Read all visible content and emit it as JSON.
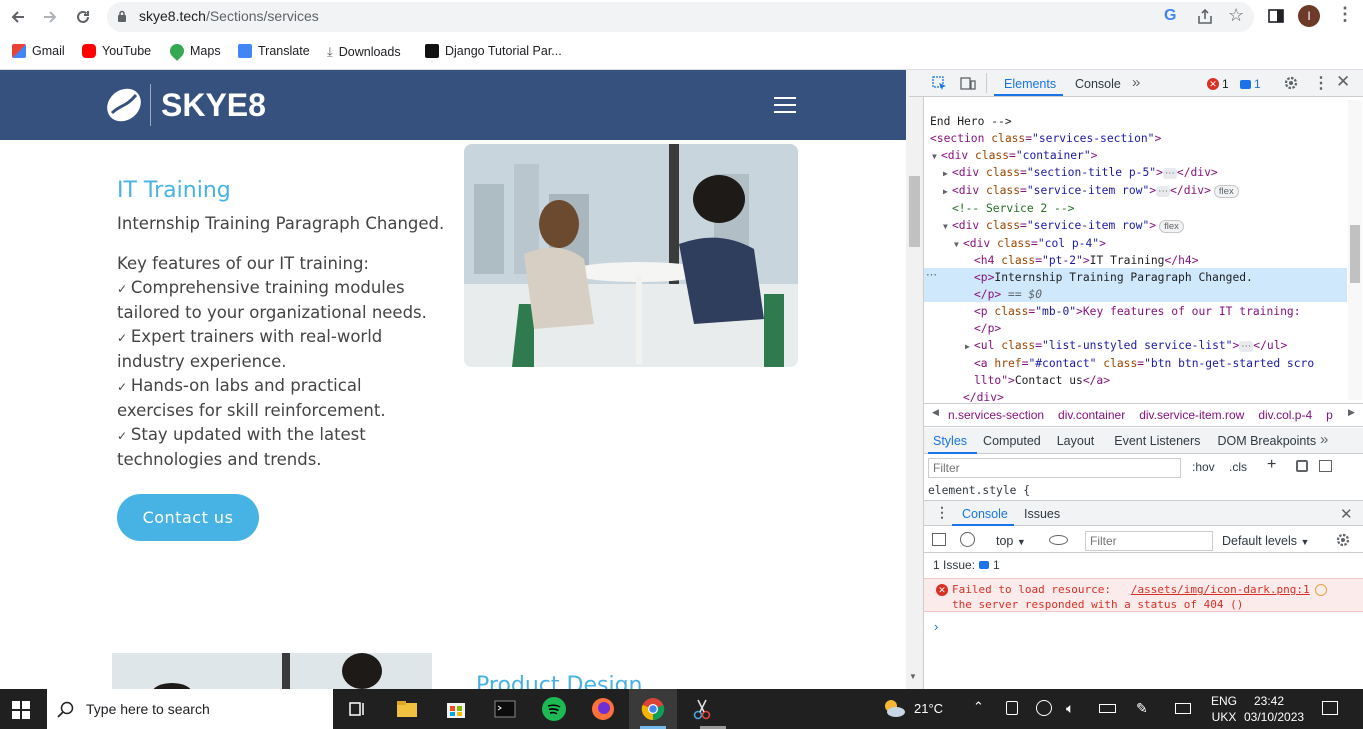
{
  "browser": {
    "url_host": "skye8.tech",
    "url_path": "/Sections/services",
    "profile_initial": "I"
  },
  "bookmarks": [
    {
      "label": "Gmail",
      "icon": "gmail-icon"
    },
    {
      "label": "YouTube",
      "icon": "youtube-icon"
    },
    {
      "label": "Maps",
      "icon": "maps-icon"
    },
    {
      "label": "Translate",
      "icon": "translate-icon"
    },
    {
      "label": "Downloads",
      "icon": "download-icon"
    },
    {
      "label": "Django Tutorial Par...",
      "icon": "django-icon"
    }
  ],
  "site": {
    "logo_text": "SKYE8",
    "service_title": "IT Training",
    "paragraph": "Internship Training Paragraph Changed.",
    "key_features_heading": "Key features of our IT training:",
    "features": [
      "Comprehensive training modules tailored to your organizational needs.",
      "Expert trainers with real-world industry experience.",
      "Hands-on labs and practical exercises for skill reinforcement.",
      "Stay updated with the latest technologies and trends."
    ],
    "contact_button": "Contact us",
    "next_title": "Product Design"
  },
  "devtools": {
    "tabs": [
      "Elements",
      "Console"
    ],
    "active_tab": "Elements",
    "error_count": "1",
    "message_count": "1",
    "dom_lines": [
      {
        "indent": 2,
        "html": "</section><span class='txt'>End Hero --></span>"
      },
      {
        "indent": 2,
        "arrow": "▼",
        "html": "<section class=\"services-section\">"
      },
      {
        "indent": 3,
        "arrow": "▼",
        "html": "<div class=\"container\">"
      },
      {
        "indent": 4,
        "arrow": "▶",
        "html": "<div class=\"section-title p-5\">",
        "ellipsis": true,
        "close": "</div>"
      },
      {
        "indent": 4,
        "arrow": "▶",
        "html": "<div class=\"service-item row\">",
        "ellipsis": true,
        "close": "</div>",
        "badge": "flex"
      },
      {
        "indent": 4,
        "comment": "<!-- Service 2 -->"
      },
      {
        "indent": 4,
        "arrow": "▼",
        "html": "<div class=\"service-item row\">",
        "badge": "flex"
      },
      {
        "indent": 5,
        "arrow": "▼",
        "html": "<div class=\"col p-4\">"
      },
      {
        "indent": 6,
        "html": "<h4 class=\"pt-2\">IT Training</h4>"
      },
      {
        "indent": 6,
        "html": "<p>Internship Training Paragraph Changed.",
        "selected": true
      },
      {
        "indent": 6,
        "html": "</p> == $0",
        "selected": true
      },
      {
        "indent": 6,
        "html": "<p class=\"mb-0\">Key features of our IT training:"
      },
      {
        "indent": 6,
        "html": "</p>"
      },
      {
        "indent": 6,
        "arrow": "▶",
        "html": "<ul class=\"list-unstyled service-list\">",
        "ellipsis": true,
        "close": "</ul>"
      },
      {
        "indent": 6,
        "html": "<a href=\"#contact\" class=\"btn btn-get-started scro"
      },
      {
        "indent": 6,
        "html": "llto\">Contact us</a>"
      },
      {
        "indent": 5,
        "html": "</div>"
      }
    ],
    "breadcrumbs": [
      "n.services-section",
      "div.container",
      "div.service-item.row",
      "div.col.p-4",
      "p"
    ],
    "style_tabs": [
      "Styles",
      "Computed",
      "Layout",
      "Event Listeners",
      "DOM Breakpoints"
    ],
    "filter_placeholder": "Filter",
    "hov": ":hov",
    "cls": ".cls",
    "element_style": "element.style {",
    "drawer_tabs": [
      "Console",
      "Issues"
    ],
    "context": "top",
    "console_filter_placeholder": "Filter",
    "levels": "Default levels",
    "issues_label": "1 Issue:",
    "issues_count": "1",
    "error_text_1": "Failed to load resource:",
    "error_link": "/assets/img/icon-dark.png:1",
    "error_text_2": "the server responded with a status of 404 ()"
  },
  "taskbar": {
    "search_placeholder": "Type here to search",
    "temperature": "21°C",
    "lang": "ENG",
    "layout": "UKX",
    "time": "23:42",
    "date": "03/10/2023"
  }
}
